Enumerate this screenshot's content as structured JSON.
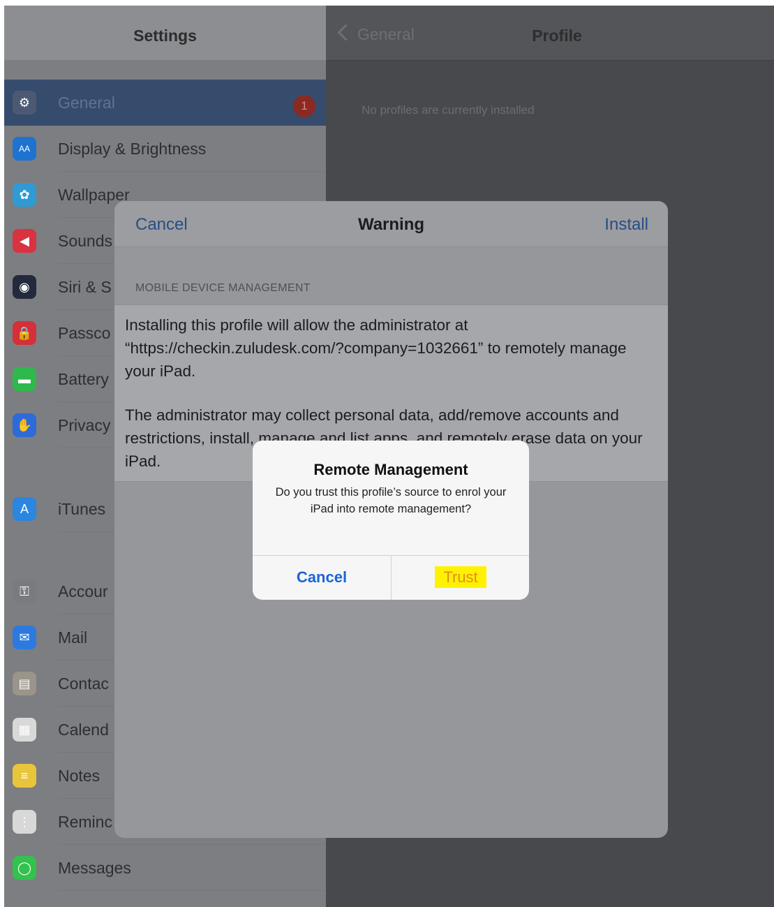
{
  "master": {
    "title": "Settings",
    "items": [
      {
        "label": "General",
        "icon": "gear-icon",
        "color": "#4b5a72",
        "badge": "1",
        "selected": true
      },
      {
        "label": "Display & Brightness",
        "icon": "display-brightness-icon",
        "color": "#1e73d1"
      },
      {
        "label": "Wallpaper",
        "icon": "wallpaper-icon",
        "color": "#2e9bd4"
      },
      {
        "label": "Sounds",
        "icon": "speaker-icon",
        "color": "#d93240"
      },
      {
        "label": "Siri & S",
        "icon": "siri-icon",
        "color": "#222a3c"
      },
      {
        "label": "Passco",
        "icon": "lock-icon",
        "color": "#d5303a"
      },
      {
        "label": "Battery",
        "icon": "battery-icon",
        "color": "#2fb84c"
      },
      {
        "label": "Privacy",
        "icon": "hand-icon",
        "color": "#2c6bd8"
      },
      {
        "label": "iTunes",
        "icon": "app-store-icon",
        "color": "#2b86e0"
      },
      {
        "label": "Accour",
        "icon": "key-icon",
        "color": "#7a7b80"
      },
      {
        "label": "Mail",
        "icon": "mail-icon",
        "color": "#2c7ae0"
      },
      {
        "label": "Contac",
        "icon": "contacts-icon",
        "color": "#9a948a"
      },
      {
        "label": "Calend",
        "icon": "calendar-icon",
        "color": "#d8d8d8"
      },
      {
        "label": "Notes",
        "icon": "notes-icon",
        "color": "#e9c53b"
      },
      {
        "label": "Reminc",
        "icon": "reminders-icon",
        "color": "#d8d8d8"
      },
      {
        "label": "Messages",
        "icon": "messages-icon",
        "color": "#32c24d"
      }
    ]
  },
  "detail": {
    "back_label": "General",
    "title": "Profile",
    "empty_text": "No profiles are currently installed"
  },
  "sheet": {
    "cancel_label": "Cancel",
    "title": "Warning",
    "install_label": "Install",
    "section_label": "MOBILE DEVICE MANAGEMENT",
    "paragraph1": "Installing this profile will allow the administrator at “https://checkin.zuludesk.com/?company=1032661” to remotely manage your iPad.",
    "paragraph2": "The administrator may collect personal data, add/remove accounts and restrictions, install, manage and list apps, and remotely erase data on your iPad."
  },
  "alert": {
    "title": "Remote Management",
    "message": "Do you trust this profile’s source to enrol your iPad into remote management?",
    "cancel_label": "Cancel",
    "trust_label": "Trust",
    "trust_highlight_color": "#fff200"
  }
}
